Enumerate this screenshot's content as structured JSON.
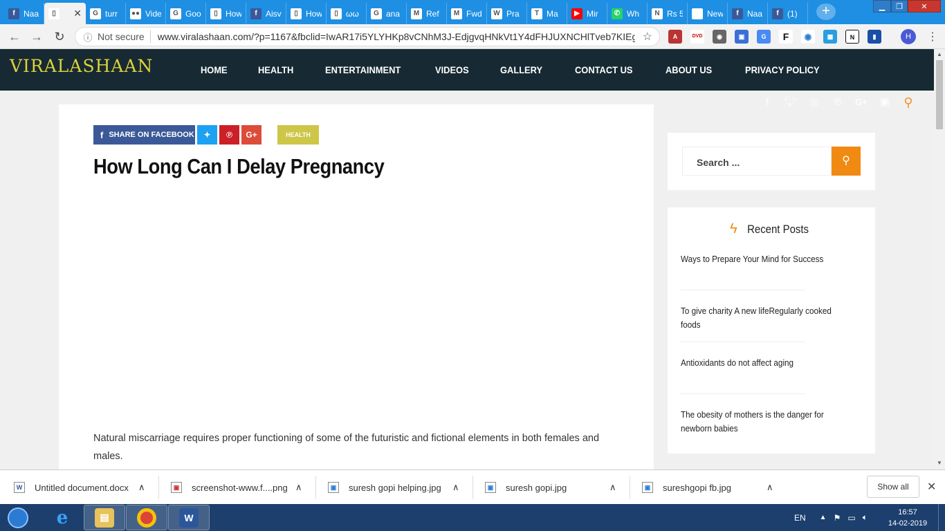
{
  "browser": {
    "tabs": [
      {
        "title": "Naa",
        "icon": "facebook-icon",
        "color": "#3b5998",
        "glyph": "f"
      },
      {
        "title": "",
        "icon": "page-icon",
        "color": "#ffffff",
        "glyph": "▯",
        "active": true
      },
      {
        "title": "turr",
        "icon": "google-icon",
        "color": "#ffffff",
        "glyph": "G"
      },
      {
        "title": "Vide",
        "icon": "flickr-icon",
        "color": "#ffffff",
        "glyph": "●●"
      },
      {
        "title": "Goo",
        "icon": "google-icon",
        "color": "#ffffff",
        "glyph": "G"
      },
      {
        "title": "How",
        "icon": "page-icon",
        "color": "#ffffff",
        "glyph": "▯"
      },
      {
        "title": "Aisv",
        "icon": "facebook-icon",
        "color": "#3b5998",
        "glyph": "f"
      },
      {
        "title": "How",
        "icon": "page-icon",
        "color": "#ffffff",
        "glyph": "▯"
      },
      {
        "title": "ωω",
        "icon": "page-icon",
        "color": "#ffffff",
        "glyph": "▯"
      },
      {
        "title": "ana",
        "icon": "google-icon",
        "color": "#ffffff",
        "glyph": "G"
      },
      {
        "title": "Ref",
        "icon": "gmail-icon",
        "color": "#ffffff",
        "glyph": "M"
      },
      {
        "title": "Fwd",
        "icon": "gmail-icon",
        "color": "#ffffff",
        "glyph": "M"
      },
      {
        "title": "Pra",
        "icon": "wikipedia-icon",
        "color": "#ffffff",
        "glyph": "W"
      },
      {
        "title": "Ma",
        "icon": "telegraph-icon",
        "color": "#ffffff",
        "glyph": "T"
      },
      {
        "title": "Mir",
        "icon": "youtube-icon",
        "color": "#ff0000",
        "glyph": "▶"
      },
      {
        "title": "Wh",
        "icon": "whatsapp-icon",
        "color": "#25d366",
        "glyph": "✆"
      },
      {
        "title": "Rs 5",
        "icon": "news-icon",
        "color": "#ffffff",
        "glyph": "N"
      },
      {
        "title": "New Tab",
        "icon": "none",
        "color": "#ffffff",
        "glyph": ""
      },
      {
        "title": "Naa",
        "icon": "facebook-icon",
        "color": "#3b5998",
        "glyph": "f"
      },
      {
        "title": "(1)",
        "icon": "facebook-icon",
        "color": "#3b5998",
        "glyph": "f"
      }
    ],
    "not_secure": "Not secure",
    "url": "www.viralashaan.com/?p=1167&fbclid=IwAR17i5YLYHKp8vCNhM3J-EdjgvqHNkVt1Y4dFHJUXNCHlTveb7KIEg...",
    "profile_initial": "H",
    "tab_close_glyph": "✕",
    "new_tab_glyph": "+",
    "back_glyph": "←",
    "forward_glyph": "→",
    "reload_glyph": "↻",
    "info_glyph": "ⓘ",
    "star_glyph": "☆",
    "menu_glyph": "⋮"
  },
  "site": {
    "logo": "VIRALASHAAN",
    "nav": [
      "HOME",
      "HEALTH",
      "ENTERTAINMENT",
      "VIDEOS",
      "GALLERY",
      "CONTACT US",
      "ABOUT US",
      "PRIVACY POLICY"
    ],
    "social_icons": [
      "facebook-icon",
      "twitter-icon",
      "instagram-icon",
      "pinterest-icon",
      "google-plus-icon",
      "youtube-icon",
      "search-icon"
    ],
    "accent": "#f08a12"
  },
  "article": {
    "share_facebook": "SHARE ON FACEBOOK",
    "share_google": "G+",
    "category": "HEALTH",
    "title": "How Long Can I Delay Pregnancy",
    "body": "Natural miscarriage requires proper functioning of some of the futuristic and fictional elements in both females and males."
  },
  "sidebar": {
    "search_placeholder": "Search ...",
    "recent_title": "Recent Posts",
    "recent_posts": [
      "Ways to Prepare Your Mind for Success",
      "To give charity A new lifeRegularly cooked foods",
      "Antioxidants do not affect aging",
      "The obesity of mothers is the danger for newborn babies"
    ]
  },
  "downloads": {
    "items": [
      {
        "name": "Untitled document.docx",
        "icon": "word-doc-icon"
      },
      {
        "name": "screenshot-www.f....png",
        "icon": "image-file-icon"
      },
      {
        "name": "suresh gopi helping.jpg",
        "icon": "image-file-icon"
      },
      {
        "name": "suresh gopi.jpg",
        "icon": "image-file-icon"
      },
      {
        "name": "sureshgopi fb.jpg",
        "icon": "image-file-icon"
      }
    ],
    "show_all": "Show all",
    "close_glyph": "✕",
    "arrow_glyph": "∧"
  },
  "taskbar": {
    "language": "EN",
    "time": "16:57",
    "date": "14-02-2019"
  }
}
